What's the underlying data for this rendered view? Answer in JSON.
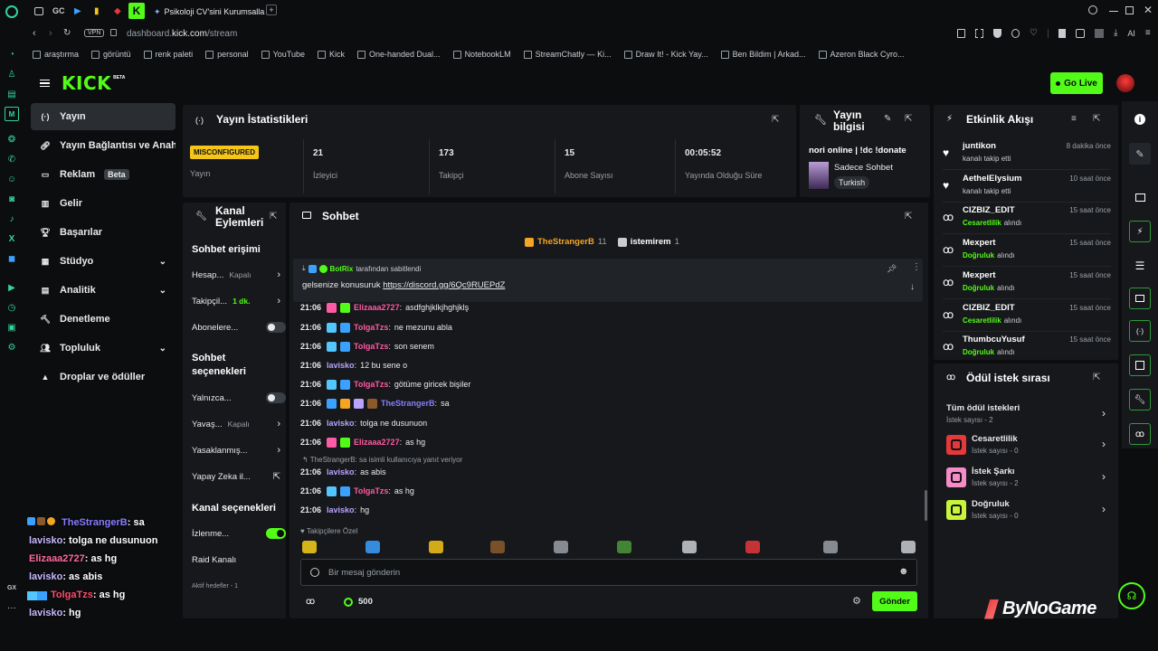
{
  "browser": {
    "tab_title": "Psikoloji CV'sini Kurumsalla",
    "url_prefix": "dashboard.",
    "url_domain": "kick.com",
    "url_path": "/stream",
    "vpn_label": "VPN",
    "gc_label": "GC",
    "ai_label": "AI"
  },
  "bookmarks": [
    "araştırma",
    "görüntü",
    "renk paleti",
    "personal",
    "YouTube",
    "Kick",
    "One-handed Dual...",
    "NotebookLM",
    "StreamChatly — Ki...",
    "Draw It! - Kick Yay...",
    "Ben Bildim | Arkad...",
    "Azeron Black Cyro..."
  ],
  "kick": {
    "logo": "KICK",
    "logo_beta": "BETA",
    "go_live": "Go Live"
  },
  "nav": [
    {
      "label": "Yayın",
      "icon": "broadcast-icon",
      "active": true
    },
    {
      "label": "Yayın Bağlantısı ve Anahtarı",
      "icon": "link-icon"
    },
    {
      "label": "Reklam",
      "icon": "ad-icon",
      "badge": "Beta"
    },
    {
      "label": "Gelir",
      "icon": "revenue-icon"
    },
    {
      "label": "Başarılar",
      "icon": "trophy-icon"
    },
    {
      "label": "Stüdyo",
      "icon": "studio-icon",
      "expand": true
    },
    {
      "label": "Analitik",
      "icon": "analytics-icon",
      "expand": true
    },
    {
      "label": "Denetleme",
      "icon": "hammer-icon"
    },
    {
      "label": "Topluluk",
      "icon": "community-icon",
      "expand": true
    },
    {
      "label": "Droplar ve ödüller",
      "icon": "drops-icon"
    }
  ],
  "stats": {
    "title": "Yayın İstatistikleri",
    "status_badge": "MISCONFIGURED",
    "status_label": "Yayın",
    "items": [
      {
        "value": "21",
        "label": "İzleyici"
      },
      {
        "value": "173",
        "label": "Takipçi"
      },
      {
        "value": "15",
        "label": "Abone Sayısı"
      },
      {
        "value": "00:05:52",
        "label": "Yayında Olduğu Süre"
      }
    ]
  },
  "stream_info": {
    "title": "Yayın bilgisi",
    "stream_title": "nori online | !dc !donate",
    "category": "Sadece Sohbet",
    "language": "Turkish"
  },
  "channel_actions": {
    "title": "Kanal Eylemleri",
    "section1": "Sohbet erişimi",
    "rows1": [
      {
        "label": "Hesap...",
        "value": "Kapalı",
        "kind": "chevron"
      },
      {
        "label": "Takipçil...",
        "value": "1 dk.",
        "kind": "chevron",
        "green": true
      },
      {
        "label": "Abonelere...",
        "value": "",
        "kind": "toggle"
      }
    ],
    "section2": "Sohbet seçenekleri",
    "rows2": [
      {
        "label": "Yalnızca...",
        "value": "",
        "kind": "toggle"
      },
      {
        "label": "Yavaş...",
        "value": "Kapalı",
        "kind": "chevron"
      },
      {
        "label": "Yasaklanmış...",
        "value": "",
        "kind": "chevron"
      },
      {
        "label": "Yapay Zeka il...",
        "value": "",
        "kind": "external"
      }
    ],
    "section3": "Kanal seçenekleri",
    "rows3": [
      {
        "label": "İzlenme...",
        "value": "",
        "kind": "toggle-on"
      },
      {
        "label": "Raid Kanalı",
        "value": "",
        "kind": "none"
      },
      {
        "label": "Aktif hedefler - 1",
        "value": "",
        "kind": "none"
      }
    ]
  },
  "chat": {
    "title": "Sohbet",
    "top_gifters": [
      {
        "name": "TheStrangerB",
        "count": "11"
      },
      {
        "name": "istemirem",
        "count": "1"
      }
    ],
    "pinned_by": "BotRix",
    "pinned_suffix": "tarafından sabitlendi",
    "pinned_text": "gelsenize konusuruk",
    "pinned_link": "https://discord.gg/6Qc9RUEPdZ",
    "reply_note": "TheStrangerB: sa isimli kullanıcıya yanıt veriyor",
    "messages": [
      {
        "time": "21:06",
        "user": "Elizaaa2727",
        "text": "asdfghjklkjhghjklş",
        "color": "#ff5aa5"
      },
      {
        "time": "21:06",
        "user": "TolgaTzs",
        "text": "ne mezunu abla",
        "color": "#ff5aa5"
      },
      {
        "time": "21:06",
        "user": "TolgaTzs",
        "text": "son senem",
        "color": "#ff5aa5"
      },
      {
        "time": "21:06",
        "user": "lavisko",
        "text": "12 bu sene o",
        "color": "#b9a4ff"
      },
      {
        "time": "21:06",
        "user": "TolgaTzs",
        "text": "götüme giricek bişiler",
        "color": "#ff5aa5"
      },
      {
        "time": "21:06",
        "user": "TheStrangerB",
        "text": "sa",
        "color": "#8a7cff"
      },
      {
        "time": "21:06",
        "user": "lavisko",
        "text": "tolga ne dusunuon",
        "color": "#b9a4ff"
      },
      {
        "time": "21:06",
        "user": "Elizaaa2727",
        "text": "as hg",
        "color": "#ff5aa5"
      },
      {
        "time": "21:06",
        "user": "lavisko",
        "text": "as abis",
        "color": "#b9a4ff"
      },
      {
        "time": "21:06",
        "user": "TolgaTzs",
        "text": "as hg",
        "color": "#ff5aa5"
      },
      {
        "time": "21:06",
        "user": "lavisko",
        "text": "hg",
        "color": "#b9a4ff"
      }
    ],
    "emote_label": "Takipçilere Özel",
    "input_placeholder": "Bir mesaj gönderin",
    "points": "500",
    "send": "Gönder"
  },
  "events": {
    "title": "Etkinlik Akışı",
    "items": [
      {
        "name": "juntikon",
        "detail": "kanalı takip etti",
        "time": "8 dakika önce",
        "icon": "heart-icon"
      },
      {
        "name": "AethelElysium",
        "detail": "kanalı takip etti",
        "time": "10 saat önce",
        "icon": "heart-icon"
      },
      {
        "name": "CIZBIZ_EDIT",
        "detail_green": "Cesaretlilik",
        "detail": "alındı",
        "time": "15 saat önce",
        "icon": "reward-icon"
      },
      {
        "name": "Mexpert",
        "detail_green": "Doğruluk",
        "detail": "alındı",
        "time": "15 saat önce",
        "icon": "reward-icon"
      },
      {
        "name": "Mexpert",
        "detail_green": "Doğruluk",
        "detail": "alındı",
        "time": "15 saat önce",
        "icon": "reward-icon"
      },
      {
        "name": "CIZBIZ_EDIT",
        "detail_green": "Cesaretlilik",
        "detail": "alındı",
        "time": "15 saat önce",
        "icon": "reward-icon"
      },
      {
        "name": "ThumbcuYusuf",
        "detail_green": "Doğruluk",
        "detail": "alındı",
        "time": "15 saat önce",
        "icon": "reward-icon"
      }
    ]
  },
  "rewards": {
    "title": "Ödül istek sırası",
    "all": "Tüm ödül istekleri",
    "all_count": "İstek sayısı - 2",
    "items": [
      {
        "name": "Cesaretlilik",
        "count": "İstek sayısı - 0",
        "color": "#e5383b"
      },
      {
        "name": "İstek Şarkı",
        "count": "İstek sayısı - 2",
        "color": "#f58bc7"
      },
      {
        "name": "Doğruluk",
        "count": "İstek sayısı - 0",
        "color": "#c8f53a"
      }
    ]
  },
  "overlay_chat": [
    {
      "user": "TheStrangerB",
      "text": ": sa",
      "color": "#8a7cff"
    },
    {
      "user": "lavisko",
      "text": ": tolga ne dusunuon",
      "color": "#c8b8ff"
    },
    {
      "user": "Elizaaa2727",
      "text": ": as hg",
      "color": "#ff6b9a"
    },
    {
      "user": "lavisko",
      "text": ": as abis",
      "color": "#c8b8ff"
    },
    {
      "user": "TolgaTzs",
      "text": ": as hg",
      "color": "#ff4d6d"
    },
    {
      "user": "lavisko",
      "text": ": hg",
      "color": "#c8b8ff"
    }
  ],
  "watermark": "ByNoGame",
  "colors": {
    "accent": "#53fc18",
    "panel": "#16181b",
    "bg": "#0b0d0f"
  }
}
